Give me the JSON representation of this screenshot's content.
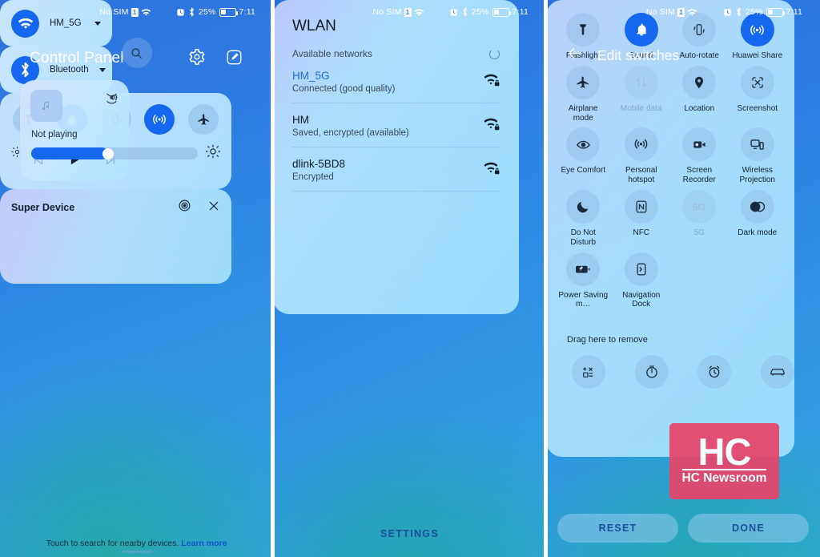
{
  "statusbar": {
    "carrier": "No SIM",
    "sim_badge": "1",
    "battery_percent": "25%",
    "time": "7:11"
  },
  "panel1": {
    "title": "Control Panel",
    "actions": [
      {
        "name": "settings-gear",
        "icon": "gear-icon"
      },
      {
        "name": "edit-switches",
        "icon": "edit-icon"
      }
    ],
    "media": {
      "status": "Not playing",
      "album_icon": "music-note-icon",
      "cast_icon": "cast-audio-icon",
      "prev_icon": "previous-track-icon",
      "play_icon": "play-icon",
      "next_icon": "next-track-icon"
    },
    "network_cards": [
      {
        "label": "HM_5G",
        "icon": "wifi-icon",
        "active": true
      },
      {
        "label": "Bluetooth",
        "icon": "bluetooth-icon",
        "active": true
      }
    ],
    "toggles": [
      {
        "name": "flashlight",
        "icon": "flashlight-icon",
        "on": false
      },
      {
        "name": "sound",
        "icon": "bell-icon",
        "on": true
      },
      {
        "name": "auto-rotate",
        "icon": "auto-rotate-icon",
        "on": false
      },
      {
        "name": "huawei-share",
        "icon": "huawei-share-icon",
        "on": true
      },
      {
        "name": "airplane-mode",
        "icon": "airplane-icon",
        "on": false
      }
    ],
    "brightness": {
      "value": 46,
      "low_icon": "brightness-low-icon",
      "high_icon": "brightness-high-icon"
    },
    "super_device": {
      "title": "Super Device",
      "target_icon": "target-icon",
      "close_icon": "close-icon",
      "search_icon": "search-icon",
      "footer_text": "Touch to search for nearby devices.",
      "footer_link": "Learn more"
    }
  },
  "panel2": {
    "wlan": {
      "title": "WLAN",
      "subtitle": "Available networks",
      "refresh_icon": "refresh-spinner-icon",
      "networks": [
        {
          "ssid": "HM_5G",
          "status": "Connected (good quality)",
          "connected": true,
          "icon": "wifi-lock-icon"
        },
        {
          "ssid": "HM",
          "status": "Saved, encrypted (available)",
          "connected": false,
          "icon": "wifi-lock-icon"
        },
        {
          "ssid": "dlink-5BD8",
          "status": "Encrypted",
          "connected": false,
          "icon": "wifi-lock-icon"
        }
      ],
      "settings_label": "SETTINGS"
    }
  },
  "panel3": {
    "back_icon": "back-arrow-icon",
    "title": "Edit switches",
    "switches": [
      {
        "label": "Flashlight",
        "icon": "flashlight-icon",
        "on": false,
        "dim": false
      },
      {
        "label": "Sound",
        "icon": "bell-icon",
        "on": true,
        "dim": false
      },
      {
        "label": "Auto-rotate",
        "icon": "auto-rotate-icon",
        "on": false,
        "dim": false
      },
      {
        "label": "Huawei Share",
        "icon": "huawei-share-icon",
        "on": true,
        "dim": false
      },
      {
        "label": "Airplane mode",
        "icon": "airplane-icon",
        "on": false,
        "dim": false
      },
      {
        "label": "Mobile data",
        "icon": "mobile-data-icon",
        "on": false,
        "dim": true
      },
      {
        "label": "Location",
        "icon": "location-pin-icon",
        "on": false,
        "dim": false
      },
      {
        "label": "Screenshot",
        "icon": "screenshot-icon",
        "on": false,
        "dim": false
      },
      {
        "label": "Eye Comfort",
        "icon": "eye-icon",
        "on": false,
        "dim": false
      },
      {
        "label": "Personal hotspot",
        "icon": "hotspot-icon",
        "on": false,
        "dim": false
      },
      {
        "label": "Screen Recorder",
        "icon": "screen-recorder-icon",
        "on": false,
        "dim": false
      },
      {
        "label": "Wireless Projection",
        "icon": "wireless-projection-icon",
        "on": false,
        "dim": false
      },
      {
        "label": "Do Not Disturb",
        "icon": "moon-icon",
        "on": false,
        "dim": false
      },
      {
        "label": "NFC",
        "icon": "nfc-icon",
        "on": false,
        "dim": false
      },
      {
        "label": "5G",
        "icon": "5g-icon",
        "on": false,
        "dim": true
      },
      {
        "label": "Dark mode",
        "icon": "dark-mode-icon",
        "on": false,
        "dim": false
      },
      {
        "label": "Power Saving m…",
        "icon": "power-saving-icon",
        "on": false,
        "dim": false
      },
      {
        "label": "Navigation Dock",
        "icon": "navigation-dock-icon",
        "on": false,
        "dim": false
      }
    ],
    "drag_text": "Drag here to remove",
    "removable": [
      {
        "name": "calculator",
        "icon": "calculator-icon"
      },
      {
        "name": "timer",
        "icon": "timer-icon"
      },
      {
        "name": "alarm",
        "icon": "alarm-icon"
      },
      {
        "name": "car-mode",
        "icon": "car-icon"
      }
    ],
    "reset_label": "RESET",
    "done_label": "DONE"
  },
  "watermark": {
    "logo": "HC",
    "text": "HC Newsroom",
    "color": "#e8456b"
  },
  "colors": {
    "accent": "#1467ee",
    "link": "#1052c8",
    "background_top": "#2a6edb",
    "background_bottom": "#31a6dd"
  }
}
